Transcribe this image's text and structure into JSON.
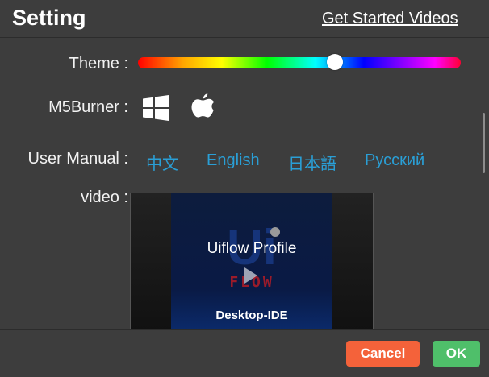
{
  "dialog": {
    "title": "Setting",
    "get_started_link": "Get Started Videos"
  },
  "theme": {
    "label": "Theme :",
    "slider_value_fraction": 0.61
  },
  "burner": {
    "label": "M5Burner :",
    "icons": [
      "windows-icon",
      "apple-icon"
    ]
  },
  "manual": {
    "label": "User Manual :",
    "links": [
      "中文",
      "English",
      "日本語",
      "Русский"
    ],
    "link_color": "#2a9fd6"
  },
  "video": {
    "label": "video :",
    "title": "Uiflow Profile",
    "logo_text": "FLOW",
    "subtitle": "Desktop-IDE"
  },
  "footer": {
    "cancel_label": "Cancel",
    "ok_label": "OK",
    "cancel_color": "#f4623a",
    "ok_color": "#4fbf6a"
  }
}
